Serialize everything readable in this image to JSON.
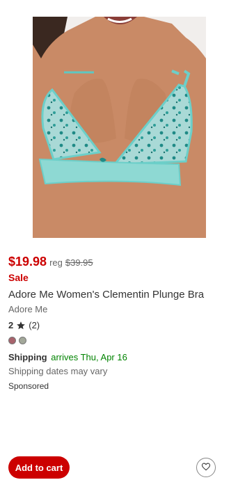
{
  "product": {
    "image_alt": "product image",
    "price_current": "$19.98",
    "price_reg_label": "reg",
    "price_reg": "$39.95",
    "sale_label": "Sale",
    "title": "Adore Me Women's Clementin Plunge Bra",
    "brand": "Adore Me",
    "rating_value": "2",
    "review_count": "(2)",
    "swatches": [
      {
        "color": "#a8636c"
      },
      {
        "color": "#a3a89a"
      }
    ],
    "shipping_label": "Shipping",
    "shipping_arrives": "arrives Thu, Apr 16",
    "shipping_note": "Shipping dates may vary",
    "sponsored": "Sponsored"
  },
  "actions": {
    "add_to_cart_label": "Add to cart",
    "favorite_icon": "heart-icon"
  },
  "colors": {
    "price_red": "#cc0000",
    "shipping_green": "#008300",
    "button_red": "#cc0000"
  }
}
